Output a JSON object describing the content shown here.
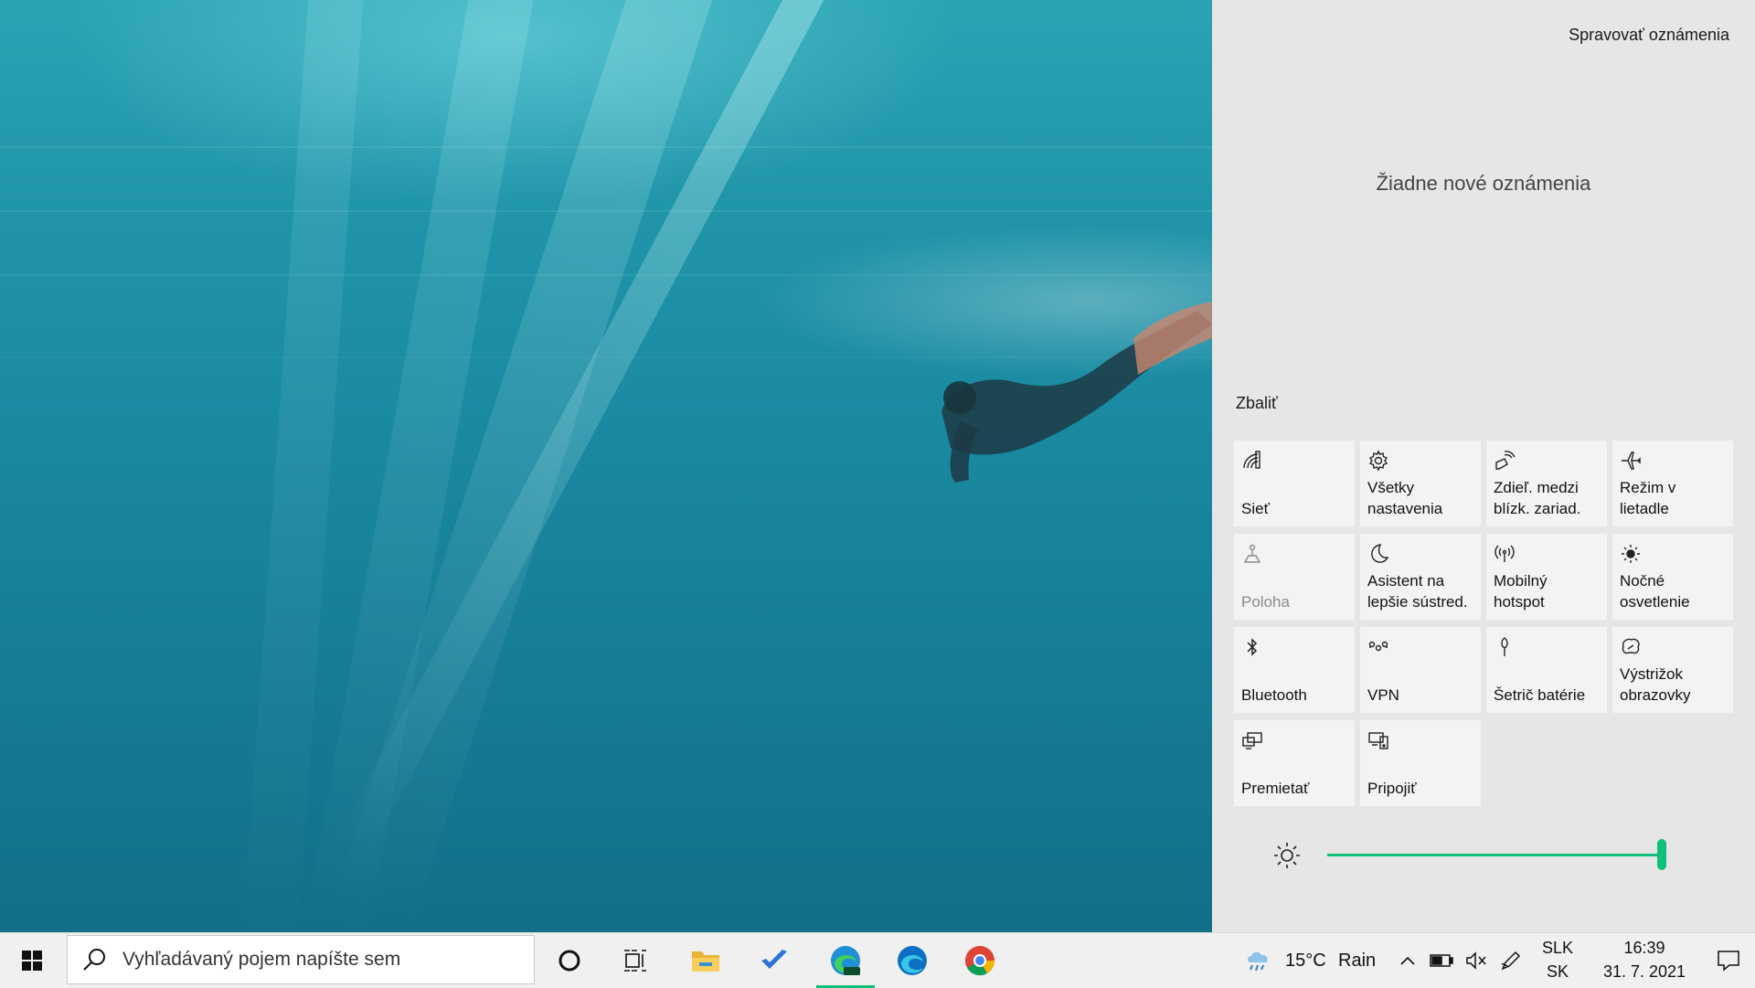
{
  "action_center": {
    "manage_notifications": "Spravovať oznámenia",
    "no_notifications": "Žiadne nové oznámenia",
    "collapse": "Zbaliť",
    "tiles": [
      {
        "label": "Sieť",
        "icon": "network-icon",
        "enabled": true
      },
      {
        "label": "Všetky\nnastavenia",
        "icon": "gear-icon",
        "enabled": true
      },
      {
        "label": "Zdieľ. medzi\nblízk. zariad.",
        "icon": "nearby-share-icon",
        "enabled": true
      },
      {
        "label": "Režim v\nlietadle",
        "icon": "airplane-icon",
        "enabled": true
      },
      {
        "label": "Poloha",
        "icon": "location-icon",
        "enabled": false
      },
      {
        "label": "Asistent na\nlepšie sústred.",
        "icon": "moon-icon",
        "enabled": true
      },
      {
        "label": "Mobilný\nhotspot",
        "icon": "hotspot-icon",
        "enabled": true
      },
      {
        "label": "Nočné\nosvetlenie",
        "icon": "night-light-icon",
        "enabled": true
      },
      {
        "label": "Bluetooth",
        "icon": "bluetooth-icon",
        "enabled": true
      },
      {
        "label": "VPN",
        "icon": "vpn-icon",
        "enabled": true
      },
      {
        "label": "Šetrič batérie",
        "icon": "battery-saver-icon",
        "enabled": true
      },
      {
        "label": "Výstrižok\nobrazovky",
        "icon": "snip-icon",
        "enabled": true
      },
      {
        "label": "Premietať",
        "icon": "project-icon",
        "enabled": true
      },
      {
        "label": "Pripojiť",
        "icon": "connect-icon",
        "enabled": true
      }
    ],
    "brightness_level": 1.0,
    "accent_color": "#0fbf7a"
  },
  "taskbar": {
    "search_placeholder": "Vyhľadávaný pojem napíšte sem",
    "weather_temp": "15°C",
    "weather_desc": "Rain",
    "language_line1": "SLK",
    "language_line2": "SK",
    "time": "16:39",
    "date": "31. 7. 2021"
  }
}
